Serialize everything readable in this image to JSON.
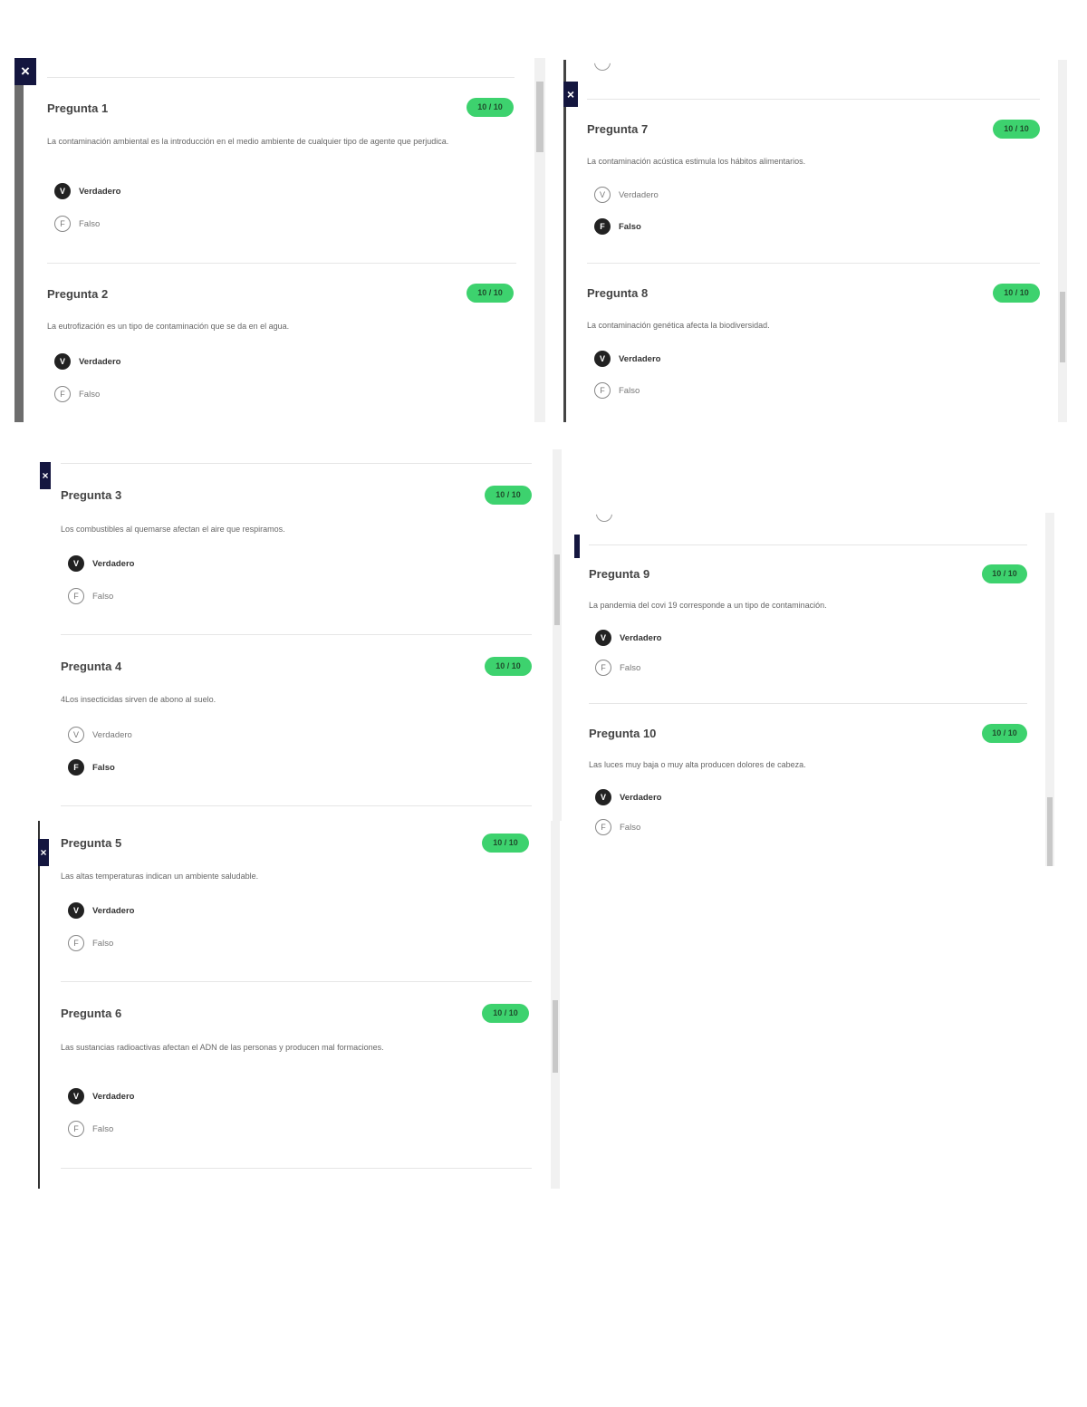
{
  "quiz": {
    "q1": {
      "title": "Pregunta 1",
      "score": "10 / 10",
      "text": "La contaminación ambiental es la introducción en el medio ambiente de cualquier tipo de agente que perjudica.",
      "options": [
        {
          "letter": "V",
          "label": "Verdadero",
          "selected": true
        },
        {
          "letter": "F",
          "label": "Falso",
          "selected": false
        }
      ]
    },
    "q2": {
      "title": "Pregunta 2",
      "score": "10 / 10",
      "text": "La eutrofización es un tipo de contaminación que se da en el agua.",
      "options": [
        {
          "letter": "V",
          "label": "Verdadero",
          "selected": true
        },
        {
          "letter": "F",
          "label": "Falso",
          "selected": false
        }
      ]
    },
    "q3": {
      "title": "Pregunta 3",
      "score": "10 / 10",
      "text": "Los combustibles al quemarse afectan el aire que respiramos.",
      "options": [
        {
          "letter": "V",
          "label": "Verdadero",
          "selected": true
        },
        {
          "letter": "F",
          "label": "Falso",
          "selected": false
        }
      ]
    },
    "q4": {
      "title": "Pregunta 4",
      "score": "10 / 10",
      "text": "4Los insecticidas sirven de abono al suelo.",
      "options": [
        {
          "letter": "V",
          "label": "Verdadero",
          "selected": false
        },
        {
          "letter": "F",
          "label": "Falso",
          "selected": true
        }
      ]
    },
    "q5": {
      "title": "Pregunta 5",
      "score": "10 / 10",
      "text": "Las altas temperaturas indican un ambiente saludable.",
      "options": [
        {
          "letter": "V",
          "label": "Verdadero",
          "selected": true
        },
        {
          "letter": "F",
          "label": "Falso",
          "selected": false
        }
      ]
    },
    "q6": {
      "title": "Pregunta 6",
      "score": "10 / 10",
      "text": "Las sustancias radioactivas afectan el ADN de las personas y producen mal formaciones.",
      "options": [
        {
          "letter": "V",
          "label": "Verdadero",
          "selected": true
        },
        {
          "letter": "F",
          "label": "Falso",
          "selected": false
        }
      ]
    },
    "q7": {
      "title": "Pregunta 7",
      "score": "10 / 10",
      "text": "La contaminación acústica estimula los hábitos alimentarios.",
      "options": [
        {
          "letter": "V",
          "label": "Verdadero",
          "selected": false
        },
        {
          "letter": "F",
          "label": "Falso",
          "selected": true
        }
      ]
    },
    "q8": {
      "title": "Pregunta 8",
      "score": "10 / 10",
      "text": "La contaminación genética afecta la biodiversidad.",
      "options": [
        {
          "letter": "V",
          "label": "Verdadero",
          "selected": true
        },
        {
          "letter": "F",
          "label": "Falso",
          "selected": false
        }
      ]
    },
    "q9": {
      "title": "Pregunta 9",
      "score": "10 / 10",
      "text": "La pandemia del covi 19 corresponde a un tipo de contaminación.",
      "options": [
        {
          "letter": "V",
          "label": "Verdadero",
          "selected": true
        },
        {
          "letter": "F",
          "label": "Falso",
          "selected": false
        }
      ]
    },
    "q10": {
      "title": "Pregunta 10",
      "score": "10 / 10",
      "text": "Las luces muy baja o muy alta producen dolores de cabeza.",
      "options": [
        {
          "letter": "V",
          "label": "Verdadero",
          "selected": true
        },
        {
          "letter": "F",
          "label": "Falso",
          "selected": false
        }
      ]
    }
  },
  "ui": {
    "close_glyph": "×"
  },
  "colors": {
    "score_badge": "#3dd26e",
    "close_button": "#14163f",
    "selected_option": "#222222"
  }
}
